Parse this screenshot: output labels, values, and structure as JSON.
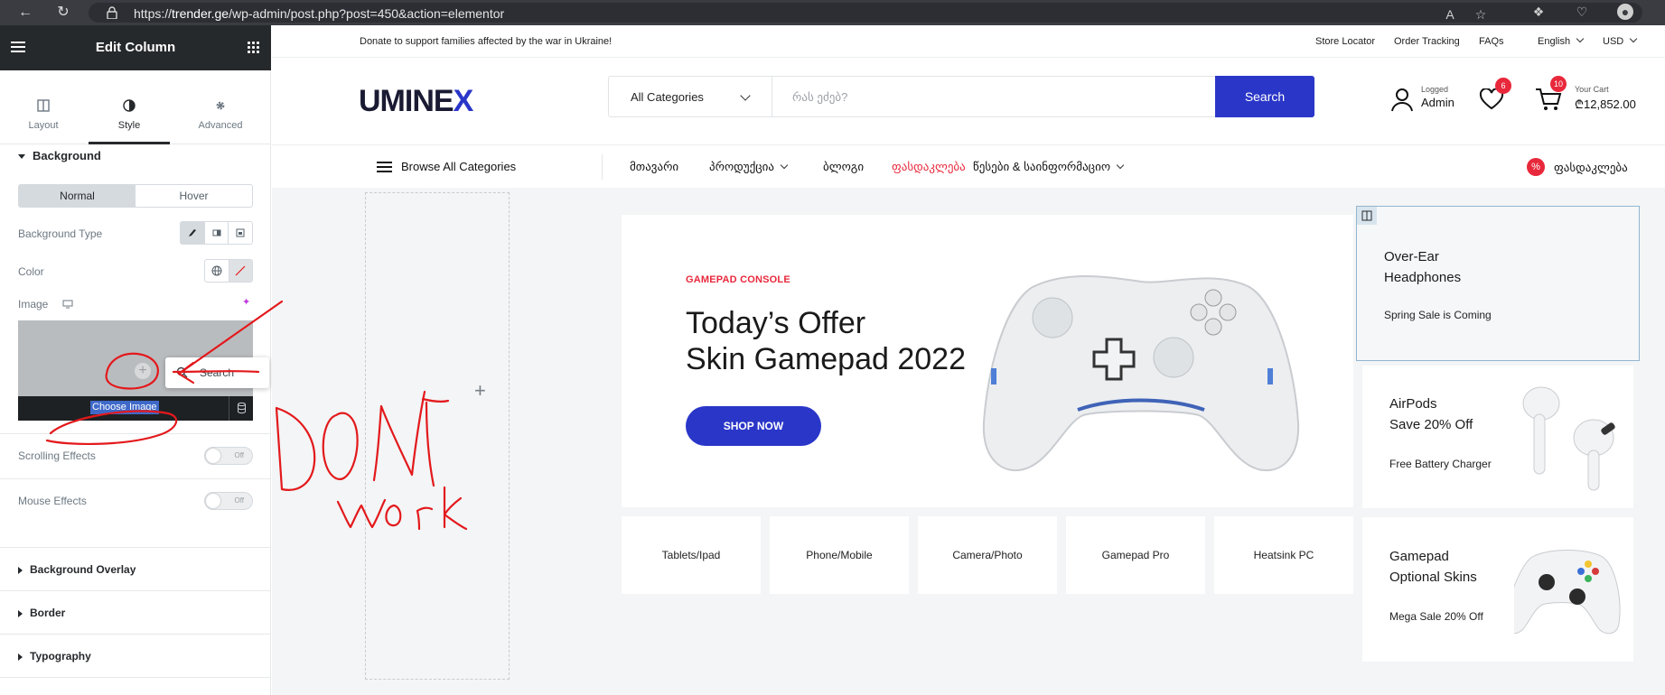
{
  "browser": {
    "url_prefix": "https://",
    "url_domain": "trender.ge",
    "url_path": "/wp-admin/post.php?post=450&action=elementor"
  },
  "panel": {
    "title": "Edit Column",
    "tabs": [
      {
        "label": "Layout",
        "icon": "layout-icon"
      },
      {
        "label": "Style",
        "icon": "contrast-icon"
      },
      {
        "label": "Advanced",
        "icon": "gear-icon"
      }
    ],
    "background_section": "Background",
    "state_tabs": [
      "Normal",
      "Hover"
    ],
    "background_type_label": "Background Type",
    "color_label": "Color",
    "image_label": "Image",
    "choose_image": "Choose Image",
    "popup_search": "Search",
    "scrolling_effects_label": "Scrolling Effects",
    "mouse_effects_label": "Mouse Effects",
    "switch_off": "Off",
    "collapsed_sections": [
      "Background Overlay",
      "Border",
      "Typography"
    ]
  },
  "annotation": {
    "text_line1": "DON'T",
    "text_line2": "work",
    "color": "#e3191c"
  },
  "site": {
    "notice": "Donate to support families affected by the war in Ukraine!",
    "top_links": [
      "Store Locator",
      "Order Tracking",
      "FAQs",
      "English",
      "USD"
    ],
    "logo_text_a": "UMINE",
    "logo_text_b": "X",
    "search_category": "All Categories",
    "search_placeholder": "რას ეძებ?",
    "search_button": "Search",
    "account_small": "Logged",
    "account_name": "Admin",
    "wishlist_count": "6",
    "cart_count": "10",
    "cart_small": "Your Cart",
    "cart_total": "₾12,852.00",
    "browse_all": "Browse All Categories",
    "nav": [
      "მთავარი",
      "პროდუქცია",
      "ბლოგი",
      "ფასდაკლება",
      "წესები & საინფორმაციო"
    ],
    "discount_label": "ფასდაკლება",
    "hero": {
      "kicker": "GAMEPAD CONSOLE",
      "title_line1": "Today’s Offer",
      "title_line2": "Skin Gamepad 2022",
      "button": "SHOP NOW"
    },
    "categories": [
      "Tablets/Ipad",
      "Phone/Mobile",
      "Camera/Photo",
      "Gamepad Pro",
      "Heatsink PC"
    ],
    "side_cards": [
      {
        "title_line1": "Over-Ear",
        "title_line2": "Headphones",
        "subtitle": "Spring Sale is Coming"
      },
      {
        "title_line1": "AirPods",
        "title_line2": "Save 20% Off",
        "subtitle": "Free Battery Charger"
      },
      {
        "title_line1": "Gamepad",
        "title_line2": "Optional Skins",
        "subtitle": "Mega Sale 20% Off"
      }
    ]
  },
  "colors": {
    "accent": "#2a36c8",
    "sale_red": "#e8283b",
    "panel_dark": "#26292c"
  }
}
